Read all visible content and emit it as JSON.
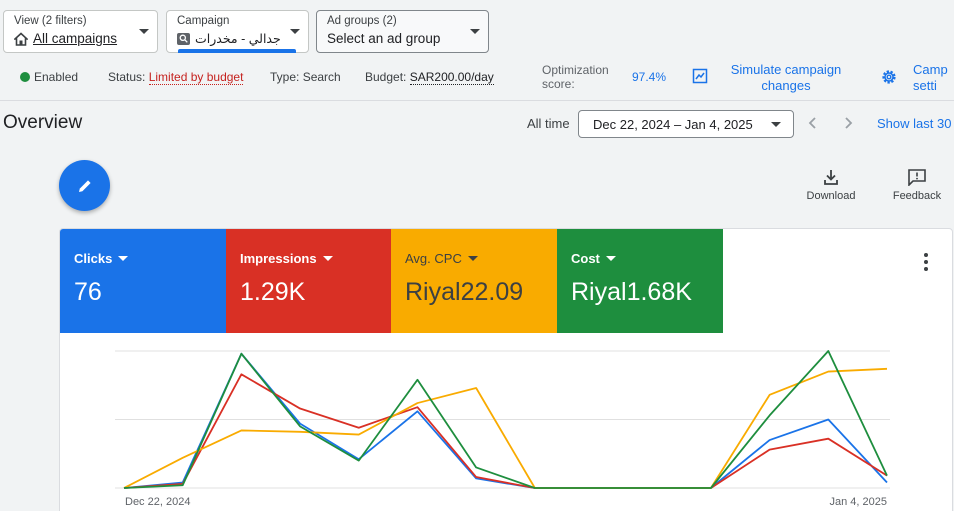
{
  "filters": {
    "view": {
      "label": "View (2 filters)",
      "value": "All campaigns"
    },
    "campaign": {
      "label": "Campaign",
      "value": "جدالي - مخدرات"
    },
    "adgroups": {
      "label": "Ad groups (2)",
      "value": "Select an ad group"
    }
  },
  "status": {
    "enabled": "Enabled",
    "status_label": "Status:",
    "status_value": "Limited by budget",
    "type_label": "Type:",
    "type_value": "Search",
    "budget_label": "Budget:",
    "budget_value": "SAR200.00/day",
    "opt_label_1": "Optimization",
    "opt_label_2": "score:",
    "opt_value": "97.4%",
    "simulate_1": "Simulate campaign",
    "simulate_2": "changes",
    "campset_1": "Camp",
    "campset_2": "setti"
  },
  "overview": {
    "title": "Overview",
    "all_time": "All time",
    "date_range": "Dec 22, 2024 – Jan 4, 2025",
    "show_last": "Show last 30"
  },
  "tools": {
    "download": "Download",
    "feedback": "Feedback"
  },
  "metrics": [
    {
      "name": "Clicks",
      "value": "76",
      "color": "#1a73e8"
    },
    {
      "name": "Impressions",
      "value": "1.29K",
      "color": "#d93025"
    },
    {
      "name": "Avg. CPC",
      "value": "Riyal22.09",
      "color": "#f9ab00"
    },
    {
      "name": "Cost",
      "value": "Riyal1.68K",
      "color": "#1e8e3e"
    }
  ],
  "chart_data": {
    "type": "line",
    "x": [
      "Dec 22, 2024",
      "Dec 23, 2024",
      "Dec 24, 2024",
      "Dec 25, 2024",
      "Dec 26, 2024",
      "Dec 27, 2024",
      "Dec 28, 2024",
      "Dec 29, 2024",
      "Dec 30, 2024",
      "Dec 31, 2024",
      "Jan 1, 2025",
      "Jan 2, 2025",
      "Jan 3, 2025",
      "Jan 4, 2025"
    ],
    "x_tick_labels": [
      "Dec 22, 2024",
      "Jan 4, 2025"
    ],
    "ylim": [
      0,
      1
    ],
    "grid": true,
    "series": [
      {
        "color": "#1a73e8",
        "values": [
          0,
          0.04,
          0.98,
          0.47,
          0.21,
          0.56,
          0.07,
          0,
          0,
          0,
          0,
          0.35,
          0.5,
          0.04
        ]
      },
      {
        "color": "#d93025",
        "values": [
          0,
          0.03,
          0.83,
          0.58,
          0.44,
          0.59,
          0.08,
          0,
          0,
          0,
          0,
          0.28,
          0.36,
          0.09
        ]
      },
      {
        "color": "#f9ab00",
        "values": [
          0,
          0.22,
          0.42,
          0.41,
          0.39,
          0.62,
          0.73,
          0,
          0,
          0,
          0,
          0.68,
          0.85,
          0.87
        ]
      },
      {
        "color": "#1e8e3e",
        "values": [
          0,
          0.02,
          0.98,
          0.45,
          0.2,
          0.79,
          0.15,
          0,
          0,
          0,
          0,
          0.53,
          1.0,
          0.09
        ]
      }
    ]
  }
}
